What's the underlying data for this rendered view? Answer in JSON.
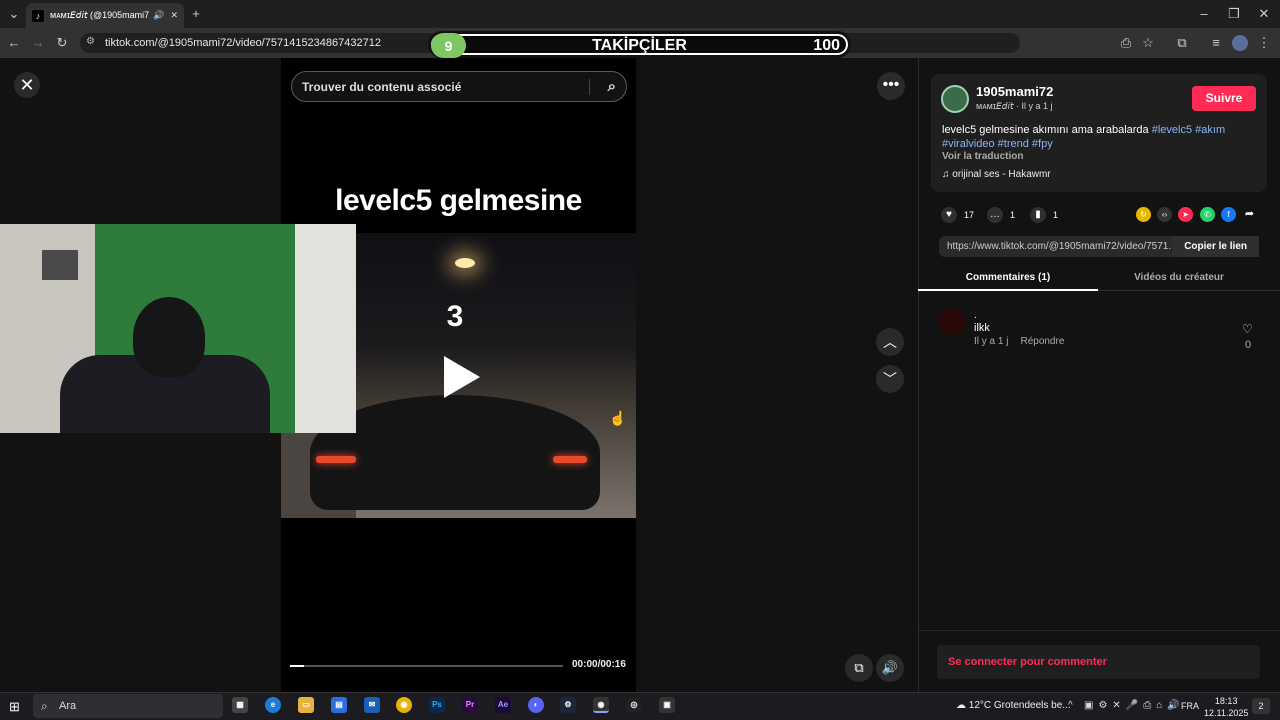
{
  "browser": {
    "tab_title": "ᴍᴀᴍɪ𝘌𝘥𝘪𝘵 (@1905mami72",
    "url": "tiktok.com/@1905mami72/video/7571415234867432712",
    "controls": {
      "back": "←",
      "forward": "→",
      "reload": "↻",
      "new_tab": "+",
      "minimize": "–",
      "restore": "❐",
      "close": "✕",
      "tab_close": "✕",
      "menu": "⋮",
      "tab_list": "⌄"
    }
  },
  "overlay": {
    "goal_left": "9",
    "title": "TAKİPÇİLER",
    "goal_right": "100"
  },
  "player": {
    "search_placeholder": "Trouver du contenu associé",
    "caption": "levelc5 gelmesine",
    "countdown": "3",
    "time": "00:00/00:16",
    "progress": 0.05
  },
  "panel": {
    "username": "1905mami72",
    "subline": "ᴍᴀᴍɪ𝘌𝘥𝘪𝘵 · Il y a 1 j",
    "follow_label": "Suivre",
    "desc_text": "levelc5 gelmesine akımını ama arabalarda",
    "tags": [
      "#levelc5",
      "#akım",
      "#viralvideo",
      "#trend",
      "#fpy"
    ],
    "translate": "Voir la traduction",
    "music": "orijinal ses - Hakawmr",
    "likes": "17",
    "comments": "1",
    "saves": "1",
    "share_url": "https://www.tiktok.com/@1905mami72/video/7571...",
    "copy_label": "Copier le lien",
    "tab_comments": "Commentaires (1)",
    "tab_videos": "Vidéos du créateur",
    "comment": {
      "name": ".",
      "text": "ilkk",
      "meta": "Il y a 1 j",
      "reply": "Répondre",
      "likes": "0"
    },
    "login": "Se connecter pour commenter"
  },
  "taskbar": {
    "search": "Ara",
    "weather": "12°C  Grotendeels be...",
    "lang": "FRA",
    "time": "18:13",
    "date": "12.11.2025",
    "notifications": "2"
  }
}
